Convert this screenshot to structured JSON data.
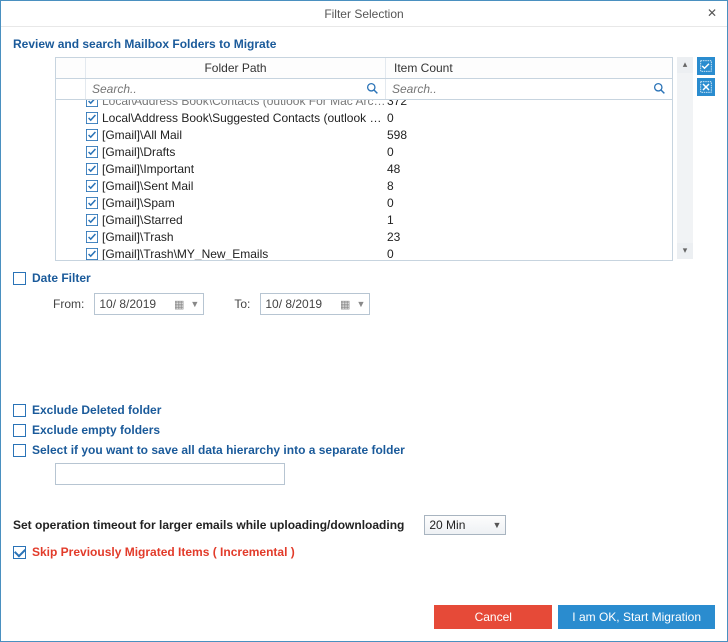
{
  "window": {
    "title": "Filter Selection"
  },
  "subtitle": "Review and search Mailbox Folders to Migrate",
  "columns": {
    "h1": "Folder Path",
    "h2": "Item Count"
  },
  "search": {
    "placeholder1": "Search..",
    "placeholder2": "Search.."
  },
  "rows": [
    {
      "path": "Local\\Address Book\\Contacts (outlook For Mac Archi...",
      "count": "372",
      "checked": true,
      "partial": true
    },
    {
      "path": "Local\\Address Book\\Suggested Contacts (outlook For...",
      "count": "0",
      "checked": true
    },
    {
      "path": "[Gmail]\\All Mail",
      "count": "598",
      "checked": true
    },
    {
      "path": "[Gmail]\\Drafts",
      "count": "0",
      "checked": true
    },
    {
      "path": "[Gmail]\\Important",
      "count": "48",
      "checked": true
    },
    {
      "path": "[Gmail]\\Sent Mail",
      "count": "8",
      "checked": true
    },
    {
      "path": "[Gmail]\\Spam",
      "count": "0",
      "checked": true
    },
    {
      "path": "[Gmail]\\Starred",
      "count": "1",
      "checked": true
    },
    {
      "path": "[Gmail]\\Trash",
      "count": "23",
      "checked": true
    },
    {
      "path": "[Gmail]\\Trash\\MY_New_Emails",
      "count": "0",
      "checked": true
    }
  ],
  "dateFilter": {
    "label": "Date Filter",
    "checked": false,
    "fromLabel": "From:",
    "toLabel": "To:",
    "fromValue": "10/  8/2019",
    "toValue": "10/  8/2019"
  },
  "options": {
    "excludeDeleted": {
      "label": "Exclude Deleted folder",
      "checked": false
    },
    "excludeEmpty": {
      "label": "Exclude empty folders",
      "checked": false
    },
    "hierarchy": {
      "label": "Select if you want to save all data hierarchy into a separate folder",
      "checked": false,
      "value": ""
    }
  },
  "timeout": {
    "label": "Set operation timeout for larger emails while uploading/downloading",
    "selected": "20 Min"
  },
  "skip": {
    "label": "Skip Previously Migrated Items ( Incremental )",
    "checked": true
  },
  "buttons": {
    "cancel": "Cancel",
    "start": "I am OK, Start Migration"
  }
}
